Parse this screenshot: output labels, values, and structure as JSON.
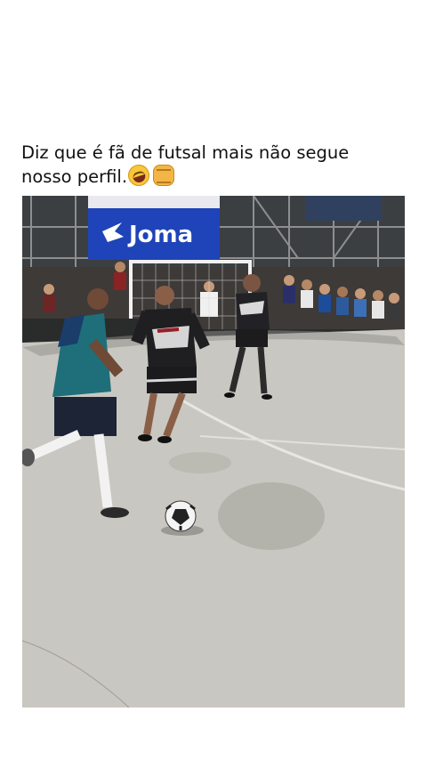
{
  "post": {
    "caption": "Diz que é fã de futsal mais não segue nosso perfil.",
    "emojis": [
      "rolling-on-floor-laughing-icon",
      "oncoming-fist-icon"
    ]
  },
  "photo": {
    "banner_text": "Joma"
  }
}
